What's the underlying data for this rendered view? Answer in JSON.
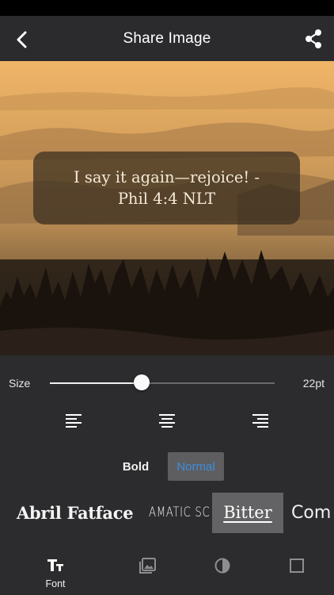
{
  "header": {
    "title": "Share Image",
    "back_icon": "chevron-left-icon",
    "share_icon": "share-icon"
  },
  "preview": {
    "quote": "I say it again—rejoice! -\nPhil 4:4 NLT",
    "background": "misty sunrise landscape with silhouetted pine trees"
  },
  "size": {
    "label": "Size",
    "value": "22pt",
    "slider_fraction": 0.41
  },
  "alignment": {
    "options": [
      "left",
      "center",
      "right"
    ]
  },
  "weight": {
    "bold_label": "Bold",
    "normal_label": "Normal",
    "selected": "Normal"
  },
  "fonts": {
    "items": [
      "Abril Fatface",
      "AMATIC SC",
      "Bitter",
      "Com"
    ],
    "selected": "Bitter"
  },
  "tabs": {
    "items": [
      {
        "label": "Font",
        "icon": "text-size-icon"
      },
      {
        "label": "",
        "icon": "image-icon"
      },
      {
        "label": "",
        "icon": "contrast-icon"
      },
      {
        "label": "",
        "icon": "square-icon"
      }
    ],
    "active": "Font"
  },
  "colors": {
    "background": "#2c2c2e",
    "accent": "#3b8ee0",
    "selected_chip": "#636365"
  }
}
